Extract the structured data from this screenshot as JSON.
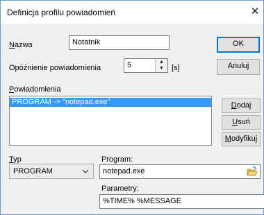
{
  "window": {
    "title": "Definicja profilu powiadomień",
    "close_glyph": "✕"
  },
  "name": {
    "label_u": "N",
    "label_rest": "azwa",
    "value": "Notatnik"
  },
  "delay": {
    "label": "Opóźnienie powiadomienia",
    "value": "5",
    "unit": "[s]"
  },
  "buttons": {
    "ok": "OK",
    "cancel": "Anuluj"
  },
  "notifications": {
    "label_u": "P",
    "label_rest": "owiadomienia",
    "items": [
      "PROGRAM -> \"notepad.exe\""
    ]
  },
  "side_buttons": {
    "add": {
      "u": "D",
      "rest": "odaj"
    },
    "remove": {
      "u": "U",
      "rest": "suń"
    },
    "modify": {
      "u": "M",
      "rest": "odyfikuj"
    }
  },
  "type": {
    "label_u": "T",
    "label_rest": "yp",
    "value": "PROGRAM"
  },
  "program": {
    "label": "Program:",
    "value": "notepad.exe"
  },
  "params": {
    "label": "Parametry:",
    "value": "%TIME% %MESSAGE"
  }
}
